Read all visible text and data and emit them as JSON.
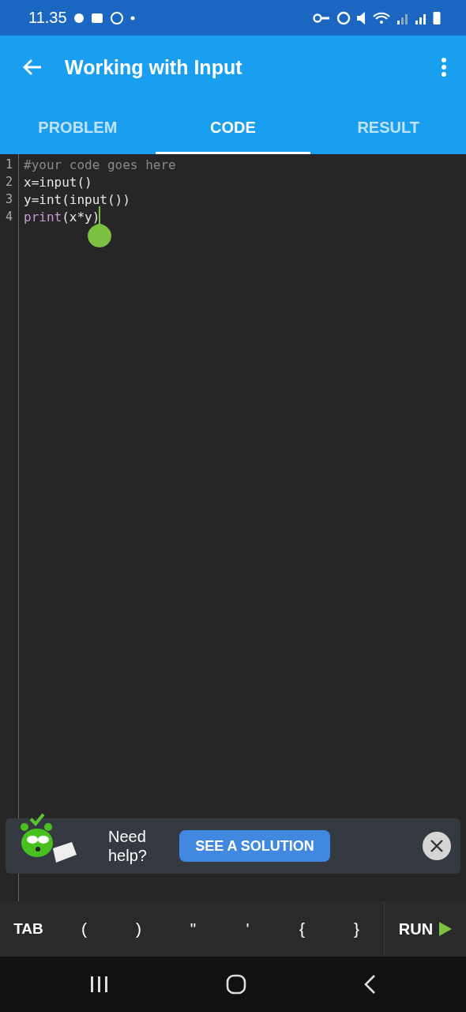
{
  "status_bar": {
    "time": "11.35"
  },
  "app_bar": {
    "title": "Working with Input"
  },
  "tabs": [
    {
      "label": "PROBLEM",
      "selected": false
    },
    {
      "label": "CODE",
      "selected": true
    },
    {
      "label": "RESULT",
      "selected": false
    }
  ],
  "editor": {
    "lines": [
      {
        "number": "1",
        "segments": [
          {
            "text": "#your code goes here",
            "kind": "comment"
          }
        ]
      },
      {
        "number": "2",
        "segments": [
          {
            "text": "x=input()",
            "kind": "plain"
          }
        ]
      },
      {
        "number": "3",
        "segments": [
          {
            "text": "y=int(input())",
            "kind": "plain"
          }
        ]
      },
      {
        "number": "4",
        "segments": [
          {
            "text": "print",
            "kind": "keyword"
          },
          {
            "text": "(x*y)",
            "kind": "plain"
          }
        ],
        "cursor": true
      }
    ]
  },
  "help_banner": {
    "text": "Need help?",
    "button": "SEE A SOLUTION"
  },
  "key_bar": {
    "keys": [
      "TAB",
      "(",
      ")",
      "\"",
      "'",
      "{",
      "}"
    ],
    "run": "RUN"
  }
}
